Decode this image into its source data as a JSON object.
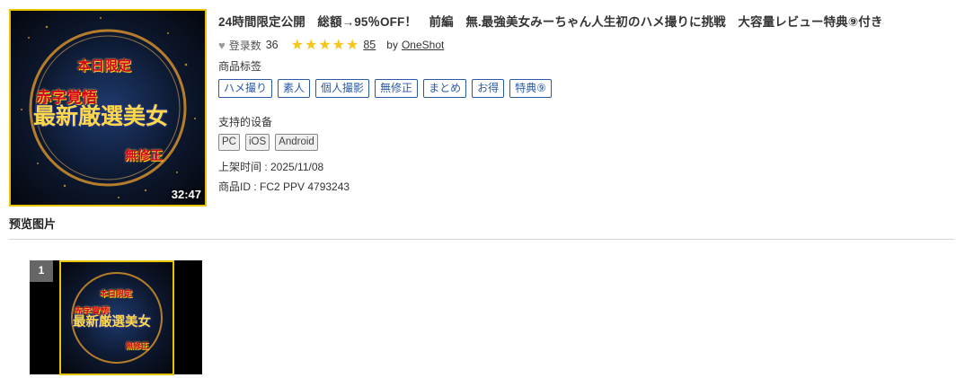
{
  "product": {
    "duration": "32:47",
    "art_text": {
      "limited": "本日限定",
      "deficit": "赤字覚悟",
      "headline": "最新厳選美女",
      "uncensored": "無修正"
    },
    "title": "24時間限定公開　総額→95％OFF！　前編　無.最強美女みーちゃん人生初のハメ撮りに挑戦　大容量レビュー特典⑨付き",
    "favorites_label": "登录数",
    "favorites_count": "36",
    "stars": "★★★★★",
    "rating_count": "85",
    "by_label": "by",
    "author": "OneShot",
    "tags_label": "商品标签",
    "tags": [
      "ハメ撮り",
      "素人",
      "個人撮影",
      "無修正",
      "まとめ",
      "お得",
      "特典⑨"
    ],
    "devices_label": "支持的设备",
    "devices": [
      "PC",
      "iOS",
      "Android"
    ],
    "release": "上架时间 : 2025/11/08",
    "product_id": "商品ID : FC2 PPV 4793243"
  },
  "preview": {
    "heading": "预览图片",
    "items": [
      {
        "index": "1"
      }
    ]
  },
  "colors": {
    "tag_blue": "#2a5aa6",
    "star_gold": "#f5c518",
    "frame_yellow": "#e8c400"
  }
}
